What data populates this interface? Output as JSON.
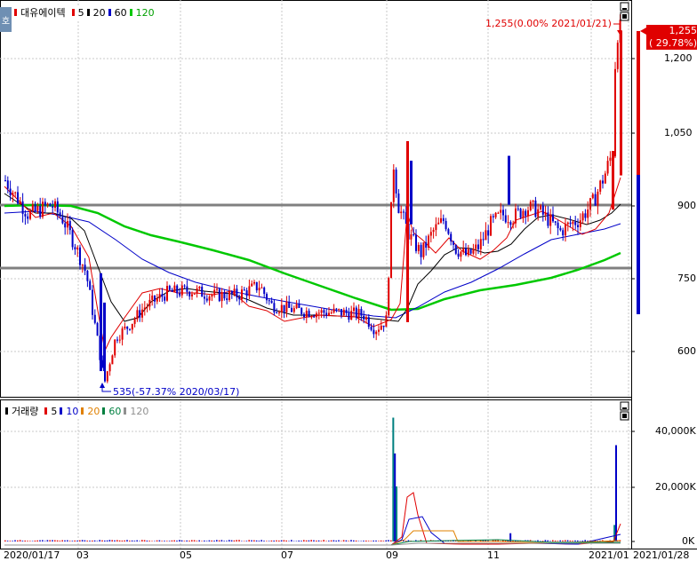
{
  "price_panel": {
    "side_tab": "호",
    "legend": {
      "stock_name": "대유에이텍",
      "ma_labels": [
        {
          "label": "5",
          "color": "#e00000"
        },
        {
          "label": "20",
          "color": "#000000"
        },
        {
          "label": "60",
          "color": "#0000c8"
        },
        {
          "label": "120",
          "color": "#00c800"
        }
      ]
    },
    "high_annotation": "1,255(0.00% 2021/01/21)",
    "low_annotation": "535(-57.37% 2020/03/17)",
    "price_tag": {
      "price": "1,255",
      "change": "( 29.78%)"
    },
    "y_ticks": [
      "1,200",
      "1,050",
      "900",
      "750",
      "600"
    ]
  },
  "volume_panel": {
    "legend": {
      "title": "거래량",
      "ma_labels": [
        {
          "label": "5",
          "color": "#e00000"
        },
        {
          "label": "10",
          "color": "#0000c8"
        },
        {
          "label": "20",
          "color": "#e08000"
        },
        {
          "label": "60",
          "color": "#008040"
        },
        {
          "label": "120",
          "color": "#909090"
        }
      ]
    },
    "y_ticks": [
      "40,000K",
      "20,000K",
      "0K"
    ]
  },
  "x_axis": {
    "labels": [
      "2020/01/17",
      "03",
      "05",
      "07",
      "09",
      "11",
      "2021/01",
      "2021/01/28"
    ]
  },
  "chart_data": {
    "type": "candlestick",
    "date_range": [
      "2020/01/17",
      "2021/01/28"
    ],
    "price_ylim": [
      530,
      1300
    ],
    "horizontal_lines": [
      900,
      775
    ],
    "price_path": [
      [
        "2020/01/17",
        950
      ],
      [
        "2020/01/24",
        915
      ],
      [
        "2020/01/31",
        880
      ],
      [
        "2020/02/07",
        890
      ],
      [
        "2020/02/14",
        900
      ],
      [
        "2020/02/21",
        870
      ],
      [
        "2020/02/28",
        820
      ],
      [
        "2020/03/06",
        760
      ],
      [
        "2020/03/13",
        620
      ],
      [
        "2020/03/17",
        535
      ],
      [
        "2020/03/24",
        630
      ],
      [
        "2020/03/31",
        650
      ],
      [
        "2020/04/10",
        690
      ],
      [
        "2020/04/24",
        720
      ],
      [
        "2020/05/08",
        725
      ],
      [
        "2020/05/22",
        715
      ],
      [
        "2020/06/05",
        715
      ],
      [
        "2020/06/19",
        735
      ],
      [
        "2020/06/26",
        695
      ],
      [
        "2020/07/10",
        685
      ],
      [
        "2020/07/24",
        680
      ],
      [
        "2020/08/07",
        680
      ],
      [
        "2020/08/21",
        675
      ],
      [
        "2020/08/28",
        645
      ],
      [
        "2020/09/04",
        665
      ],
      [
        "2020/09/08",
        990
      ],
      [
        "2020/09/11",
        900
      ],
      [
        "2020/09/18",
        835
      ],
      [
        "2020/09/25",
        800
      ],
      [
        "2020/10/02",
        845
      ],
      [
        "2020/10/09",
        870
      ],
      [
        "2020/10/16",
        810
      ],
      [
        "2020/10/23",
        795
      ],
      [
        "2020/10/30",
        815
      ],
      [
        "2020/11/06",
        860
      ],
      [
        "2020/11/13",
        880
      ],
      [
        "2020/11/20",
        875
      ],
      [
        "2020/11/27",
        895
      ],
      [
        "2020/12/04",
        890
      ],
      [
        "2020/12/11",
        870
      ],
      [
        "2020/12/18",
        845
      ],
      [
        "2020/12/24",
        860
      ],
      [
        "2020/12/30",
        870
      ],
      [
        "2021/01/07",
        905
      ],
      [
        "2021/01/14",
        960
      ],
      [
        "2021/01/19",
        1010
      ],
      [
        "2021/01/21",
        1255
      ],
      [
        "2021/01/28",
        1255
      ]
    ],
    "ma_series": [
      {
        "name": "5",
        "color": "#e00000"
      },
      {
        "name": "20",
        "color": "#000000"
      },
      {
        "name": "60",
        "color": "#0000c8"
      },
      {
        "name": "120",
        "color": "#00c800"
      }
    ],
    "volume_ylim_K": [
      0,
      48000
    ],
    "volume_spikes_K": [
      [
        "2020/09/08",
        45000
      ],
      [
        "2020/09/09",
        32000
      ],
      [
        "2020/09/10",
        20000
      ],
      [
        "2020/11/18",
        3000
      ],
      [
        "2021/01/20",
        6000
      ],
      [
        "2021/01/21",
        35000
      ]
    ]
  }
}
